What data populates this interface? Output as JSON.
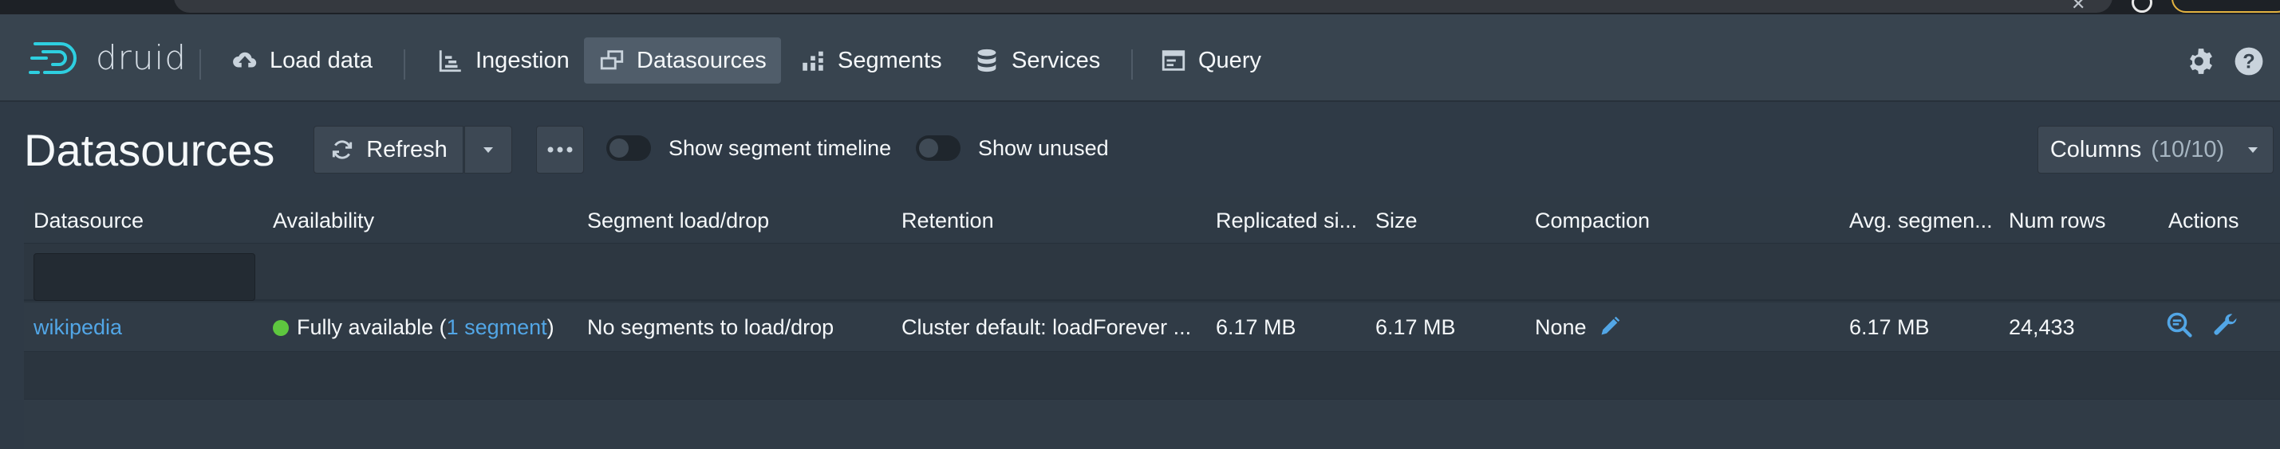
{
  "nav": {
    "logo_text": "druid",
    "items": [
      {
        "label": "Load data"
      },
      {
        "label": "Ingestion"
      },
      {
        "label": "Datasources"
      },
      {
        "label": "Segments"
      },
      {
        "label": "Services"
      },
      {
        "label": "Query"
      }
    ],
    "active_item": "Datasources"
  },
  "page": {
    "title": "Datasources",
    "refresh_label": "Refresh",
    "toggles": [
      {
        "label": "Show segment timeline",
        "on": false
      },
      {
        "label": "Show unused",
        "on": false
      }
    ],
    "columns_label": "Columns",
    "columns_count": "(10/10)"
  },
  "table": {
    "headers": [
      "Datasource",
      "Availability",
      "Segment load/drop",
      "Retention",
      "Replicated si...",
      "Size",
      "Compaction",
      "Avg. segmen...",
      "Num rows",
      "Actions"
    ],
    "rows": [
      {
        "datasource": "wikipedia",
        "availability_text": "Fully available (",
        "availability_link": "1 segment",
        "availability_close": ")",
        "load_drop": "No segments to load/drop",
        "retention": "Cluster default: loadForever ...",
        "replicated_size": "6.17 MB",
        "size": "6.17 MB",
        "compaction": "None",
        "avg_segment": "6.17 MB",
        "num_rows": "24,433"
      }
    ]
  },
  "colors": {
    "link": "#52a6e6",
    "available": "#5ec73f",
    "navbar": "#38444f",
    "background": "#2f3a46"
  }
}
